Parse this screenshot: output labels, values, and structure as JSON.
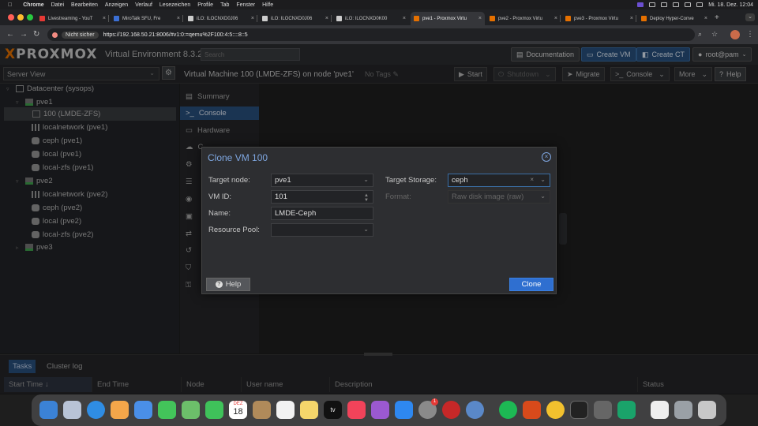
{
  "menubar": {
    "app": "Chrome",
    "items": [
      "Datei",
      "Bearbeiten",
      "Anzeigen",
      "Verlauf",
      "Lesezeichen",
      "Profile",
      "Tab",
      "Fenster",
      "Hilfe"
    ],
    "clock": "Mi. 18. Dez. 12:04"
  },
  "browser": {
    "tabs": [
      {
        "title": "Livestreaming - YouT",
        "color": "#e53935"
      },
      {
        "title": "MiroTalk SFU, Fre",
        "color": "#3b6fd4"
      },
      {
        "title": "iLO: ILOCNXD0J06",
        "color": "#cccccc"
      },
      {
        "title": "iLO: ILOCNXD0J06",
        "color": "#cccccc"
      },
      {
        "title": "iLO: ILOCNXD0K00",
        "color": "#cccccc"
      },
      {
        "title": "pve1 - Proxmox Virtu",
        "color": "#e57000"
      },
      {
        "title": "pve2 - Proxmox Virtu",
        "color": "#e57000"
      },
      {
        "title": "pve3 - Proxmox Virtu",
        "color": "#e57000"
      },
      {
        "title": "Deploy Hyper-Conve",
        "color": "#e57000"
      }
    ],
    "not_secure": "Nicht sicher",
    "url": "https://192.168.50.21:8006/#v1:0:=qemu%2F100:4:5::::8::5"
  },
  "pve": {
    "logo": "PROXMOX",
    "product": "Virtual Environment 8.3.2",
    "search_placeholder": "Search",
    "documentation": "Documentation",
    "create_vm": "Create VM",
    "create_ct": "Create CT",
    "user": "root@pam",
    "server_view": "Server View",
    "vm_title": "Virtual Machine 100 (LMDE-ZFS) on node 'pve1'",
    "no_tags": "No Tags",
    "actions": {
      "start": "Start",
      "shutdown": "Shutdown",
      "migrate": "Migrate",
      "console": "Console",
      "more": "More",
      "help": "Help"
    }
  },
  "tree": {
    "datacenter": "Datacenter (sysops)",
    "pve1": "pve1",
    "vm100": "100 (LMDE-ZFS)",
    "pve1_net": "localnetwork (pve1)",
    "pve1_ceph": "ceph (pve1)",
    "pve1_local": "local (pve1)",
    "pve1_zfs": "local-zfs (pve1)",
    "pve2": "pve2",
    "pve2_net": "localnetwork (pve2)",
    "pve2_ceph": "ceph (pve2)",
    "pve2_local": "local (pve2)",
    "pve2_zfs": "local-zfs (pve2)",
    "pve3": "pve3"
  },
  "vmnav": {
    "summary": "Summary",
    "console": "Console",
    "hardware": "Hardware",
    "c_partial": "C"
  },
  "bottom": {
    "tasks": "Tasks",
    "cluster_log": "Cluster log",
    "columns": [
      "Start Time",
      "End Time",
      "Node",
      "User name",
      "Description",
      "Status"
    ]
  },
  "dock": {
    "calendar_month": "DEZ",
    "calendar_day": "18",
    "badge": "1",
    "tv_label": "tv"
  },
  "modal": {
    "title": "Clone VM 100",
    "target_node_label": "Target node:",
    "target_node": "pve1",
    "vm_id_label": "VM ID:",
    "vm_id": "101",
    "name_label": "Name:",
    "name": "LMDE-Ceph",
    "pool_label": "Resource Pool:",
    "pool": "",
    "target_storage_label": "Target Storage:",
    "target_storage": "ceph",
    "format_label": "Format:",
    "format": "Raw disk image (raw)",
    "help": "Help",
    "clone": "Clone"
  }
}
